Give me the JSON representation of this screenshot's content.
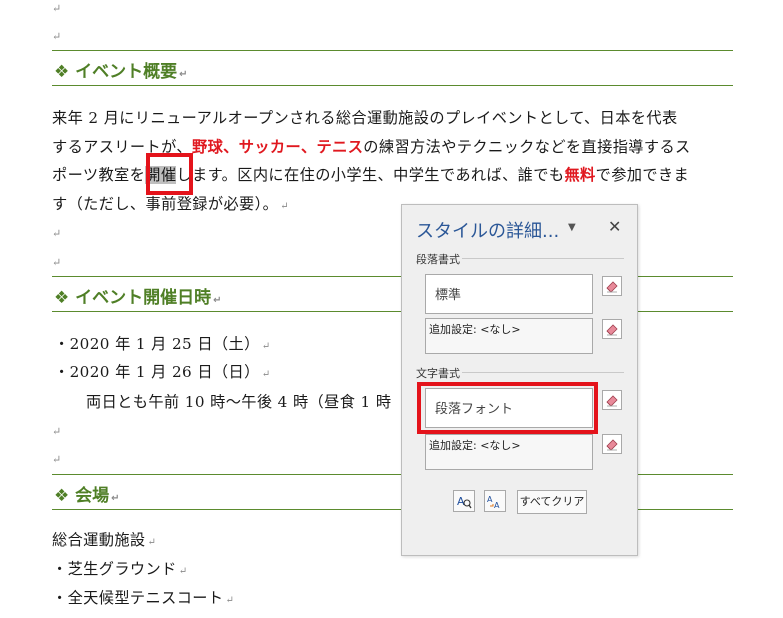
{
  "document": {
    "para_mark": "↵",
    "heading1": "❖ イベント概要",
    "intro_lines": {
      "l1": "来年 2 月にリニューアルオープンされる総合運動施設のプレイベントとして、日本を代表",
      "l2_a": "するアスリートが、",
      "l2_red": "野球、サッカー、テニス",
      "l2_b": "の練習方法やテクニックなどを直接指導するス",
      "l3_a": "ポーツ教室を",
      "l3_sel": "開催",
      "l3_b": "します。区内に在住の小学生、中学生であれば、誰でも",
      "l3_red": "無料",
      "l3_c": "で参加できま",
      "l4": "す（ただし、事前登録が必要）。"
    },
    "heading2": "❖ イベント開催日時",
    "dates": [
      "・2020 年 1 月 25 日（土）",
      "・2020 年 1 月 26 日（日）"
    ],
    "time_line": "両日とも午前 10 時～午後 4 時（昼食 1 時",
    "heading3": "❖ 会場",
    "venue": [
      "総合運動施設",
      "・芝生グラウンド",
      "・全天候型テニスコート"
    ]
  },
  "panel": {
    "title": "スタイルの詳細...",
    "dropdown_glyph": "▼",
    "close_glyph": "✕",
    "paragraph_section": "段落書式",
    "paragraph_style": "標準",
    "paragraph_extra": "追加設定: <なし>",
    "character_section": "文字書式",
    "character_style": "段落フォント",
    "character_extra": "追加設定: <なし>",
    "clear_all": "すべてクリア",
    "icons": [
      "eraser-icon",
      "reveal-formatting-icon",
      "compare-formatting-icon"
    ]
  },
  "colors": {
    "heading_green": "#4f7f26",
    "emphasis_red": "#e0181f",
    "callout_red": "#e4131b",
    "panel_title_blue": "#2b5797"
  }
}
